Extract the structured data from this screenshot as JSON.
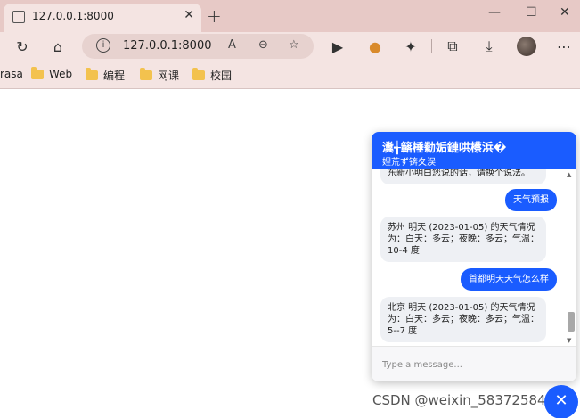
{
  "tab": {
    "title": "127.0.0.1:8000",
    "close": "✕"
  },
  "new_tab": "+",
  "window_controls": {
    "minimize": "—",
    "maximize": "☐",
    "close": "✕"
  },
  "address_bar": {
    "url": "127.0.0.1:8000",
    "info": "i"
  },
  "toolbar_icons": {
    "back": "↻",
    "home": "⌂",
    "read_aloud": "A",
    "zoom": "⊖",
    "favorite": "☆",
    "play": "▶",
    "extensions": "✦",
    "collections": "⧉",
    "downloads": "⤓",
    "more": "⋯"
  },
  "bookmarks": [
    "rasa",
    "Web",
    "编程",
    "网课",
    "校园"
  ],
  "chat": {
    "title": "瀵╅簵棰勬姤鏈哄櫒浜�",
    "subtitle": "娌荒ず锛夊洖",
    "messages": [
      {
        "role": "bot",
        "text": "东新小明白您说的话，请换个说法。"
      },
      {
        "role": "user",
        "text": "天气预报"
      },
      {
        "role": "bot",
        "text": "苏州 明天 (2023-01-05) 的天气情况为：白天：多云；夜晚：多云；气温：10-4 度"
      },
      {
        "role": "user",
        "text": "首都明天天气怎么样"
      },
      {
        "role": "bot",
        "text": "北京 明天 (2023-01-05) 的天气情况为：白天：多云；夜晚：多云；气温：5--7 度"
      }
    ],
    "input_placeholder": "Type a message..."
  },
  "fab_icon": "✕",
  "watermark": "CSDN @weixin_58372584",
  "colors": {
    "accent": "#1a5cff",
    "chrome": "#e7c9c6"
  }
}
